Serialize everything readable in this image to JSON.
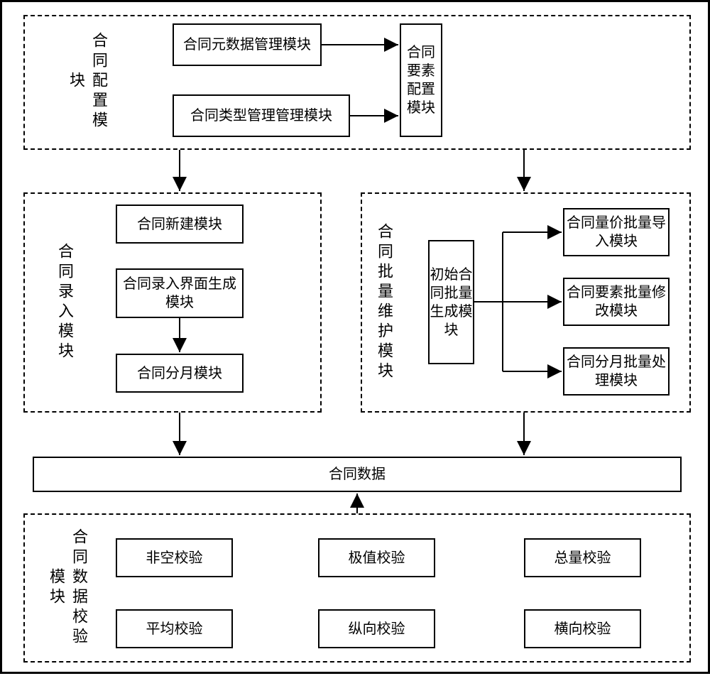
{
  "sections": {
    "config": {
      "title": "合同配置模块",
      "box_metadata": "合同元数据管理模块",
      "box_type": "合同类型管理管理模块",
      "box_element": "合同要素配置模块"
    },
    "entry": {
      "title": "合同录入模块",
      "box_new": "合同新建模块",
      "box_ui_gen": "合同录入界面生成模块",
      "box_month": "合同分月模块"
    },
    "batch": {
      "title": "合同批量维护模块",
      "box_initial": "初始合同批量生成模块",
      "box_qp": "合同量价批量导入模块",
      "box_elem_mod": "合同要素批量修改模块",
      "box_month_proc": "合同分月批量处理模块"
    },
    "data_bar": "合同数据",
    "validate": {
      "title": "合同数据校验模块",
      "v1": "非空校验",
      "v2": "极值校验",
      "v3": "总量校验",
      "v4": "平均校验",
      "v5": "纵向校验",
      "v6": "横向校验"
    }
  }
}
